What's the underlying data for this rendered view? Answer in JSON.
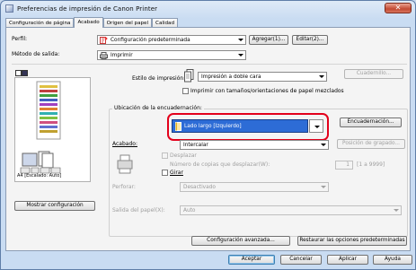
{
  "window": {
    "title": "Preferencias de impresión de Canon Printer",
    "close_glyph": "✕"
  },
  "tabs": [
    {
      "label": "Configuración de página",
      "active": false
    },
    {
      "label": "Acabado",
      "active": true
    },
    {
      "label": "Origen del papel",
      "active": false
    },
    {
      "label": "Calidad",
      "active": false
    }
  ],
  "profile": {
    "label": "Perfil:",
    "value": "Configuración predeterminada",
    "add_button": "Agregar(1)...",
    "edit_button": "Editar(2)..."
  },
  "output_method": {
    "label": "Método de salida:",
    "value": "Imprimir"
  },
  "preview": {
    "caption": "A4 [Escalado: Auto]"
  },
  "print_style": {
    "label": "Estilo de impresión:",
    "value": "Impresión a doble cara",
    "booklet_button": "Cuadernillo...",
    "mixed_paper_label": "Imprimir con tamaños/orientaciones de papel mezclados"
  },
  "binding": {
    "label": "Ubicación de la encuadernación:",
    "value": "Lado largo [Izquierdo]",
    "gutter_button": "Encuadernación..."
  },
  "finishing": {
    "label": "Acabado:",
    "value": "Intercalar",
    "offset_button": "Posición de grapado...",
    "shift_label": "Desplazar",
    "shift_count_label": "Número de copias que desplazar(W):",
    "shift_count_value": "1",
    "shift_range": "[1 a 9999]",
    "rotate_label": "Girar"
  },
  "punch": {
    "label": "Perforar:",
    "value": "Desactivado"
  },
  "show_settings_button": "Mostrar configuración",
  "paper_output": {
    "label": "Salida del papel(X):",
    "value": "Auto"
  },
  "advanced_button": "Configuración avanzada...",
  "restore_button": "Restaurar las opciones predeterminadas",
  "footer": {
    "ok": "Aceptar",
    "cancel": "Cancelar",
    "apply": "Aplicar",
    "help": "Ayuda"
  }
}
